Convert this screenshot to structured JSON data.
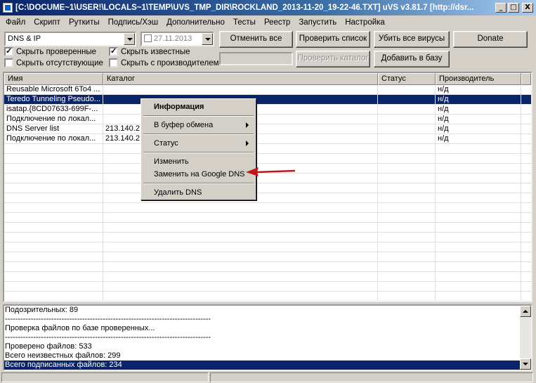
{
  "window": {
    "title": "[C:\\DOCUME~1\\USER!\\LOCALS~1\\TEMP\\UVS_TMP_DIR\\ROCKLAND_2013-11-20_19-22-46.TXT] uVS v3.81.7 [http://dsr...",
    "min_glyph": "_",
    "max_glyph": "□",
    "close_glyph": "X"
  },
  "menu": [
    "Файл",
    "Скрипт",
    "Руткиты",
    "Подпись/Хэш",
    "Дополнительно",
    "Тесты",
    "Реестр",
    "Запустить",
    "Настройка"
  ],
  "toolbar": {
    "category_value": "DNS & IP",
    "date_value": "27.11.2013",
    "cancel_all": "Отменить все",
    "check_list": "Проверить список",
    "kill_viruses": "Убить все вирусы",
    "donate": "Donate",
    "check_folder": "Проверить каталог",
    "add_to_db": "Добавить в базу",
    "hide_checked": "Скрыть проверенные",
    "hide_known": "Скрыть известные",
    "hide_missing": "Скрыть отсутствующие",
    "hide_with_vendor": "Скрыть с производителем",
    "checkmark": "✓"
  },
  "table": {
    "columns": [
      "Имя",
      "Каталог",
      "Статус",
      "Производитель"
    ],
    "rows": [
      {
        "name": "Reusable Microsoft 6To4 ...",
        "folder": "",
        "status": "",
        "vendor": "н/д"
      },
      {
        "name": "Teredo Tunneling Pseudo...",
        "folder": "",
        "status": "",
        "vendor": "н/д"
      },
      {
        "name": "isatap.{8CD07633-699F-...",
        "folder": "",
        "status": "",
        "vendor": "н/д"
      },
      {
        "name": "Подключение по локал...",
        "folder": "",
        "status": "",
        "vendor": "н/д"
      },
      {
        "name": "DNS Server list",
        "folder": "213.140.2",
        "status": "",
        "vendor": "н/д"
      },
      {
        "name": "Подключение по локал...",
        "folder": "213.140.2",
        "status": "",
        "vendor": "н/д"
      }
    ]
  },
  "context_menu": {
    "info": "Информация",
    "clipboard": "В буфер обмена",
    "status": "Статус",
    "edit": "Изменить",
    "google_dns": "Заменить на Google DNS",
    "delete_dns": "Удалить DNS"
  },
  "log": [
    "Подозрительных: 89",
    "--------------------------------------------------------------------------------",
    "Проверка файлов по базе проверенных...",
    "--------------------------------------------------------------------------------",
    "Проверено файлов: 533",
    "Всего неизвестных файлов: 299",
    "Всего подписанных файлов: 234"
  ],
  "colors": {
    "selection": "#0a246a",
    "annotation_arrow": "#c0161c"
  }
}
